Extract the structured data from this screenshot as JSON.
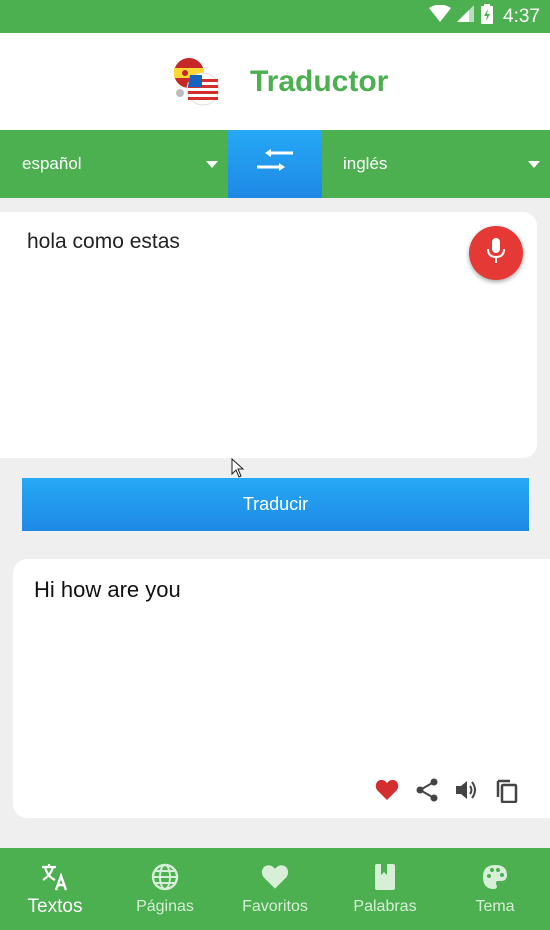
{
  "status_bar": {
    "time": "4:37"
  },
  "app": {
    "title": "Traductor"
  },
  "languages": {
    "source": "español",
    "target": "inglés"
  },
  "input": {
    "text": "hola como estas"
  },
  "translate_button": {
    "label": "Traducir"
  },
  "output": {
    "text": "Hi how are you"
  },
  "bottom_nav": {
    "items": [
      {
        "label": "Textos"
      },
      {
        "label": "Páginas"
      },
      {
        "label": "Favoritos"
      },
      {
        "label": "Palabras"
      },
      {
        "label": "Tema"
      }
    ]
  },
  "colors": {
    "primary": "#4caf50",
    "accent": "#1e88e5",
    "mic": "#e53935",
    "favorite": "#d32f2f"
  }
}
